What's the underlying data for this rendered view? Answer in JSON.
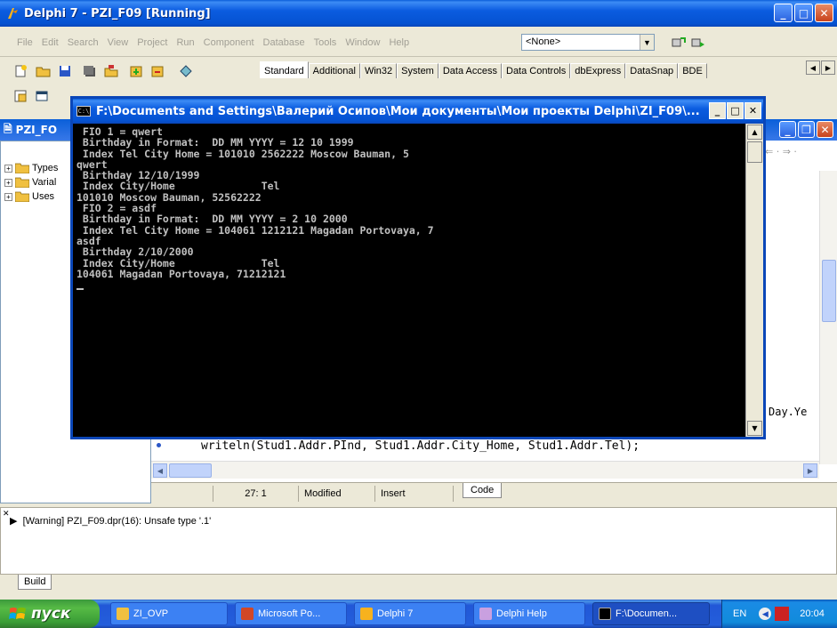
{
  "main_window": {
    "title": "Delphi 7 - PZI_F09 [Running]",
    "buttons": {
      "minimize": "_",
      "maximize": "□",
      "close": "✕"
    }
  },
  "menu": {
    "items": [
      "File",
      "Edit",
      "Search",
      "View",
      "Project",
      "Run",
      "Component",
      "Database",
      "Tools",
      "Window",
      "Help"
    ],
    "combo_value": "<None>"
  },
  "palette": {
    "tabs": [
      "Standard",
      "Additional",
      "Win32",
      "System",
      "Data Access",
      "Data Controls",
      "dbExpress",
      "DataSnap",
      "BDE"
    ]
  },
  "explorer": {
    "title": "PZI_FO",
    "tree": [
      "Types",
      "Varial",
      "Uses"
    ]
  },
  "editor": {
    "code_line": "writeln(Stud1.Addr.PInd, Stud1.Addr.City_Home, Stud1.Addr.Tel);",
    "code_day": "Day.Ye",
    "status": {
      "position": "27:   1",
      "modified": "Modified",
      "insert": "Insert",
      "tab": "Code"
    }
  },
  "console": {
    "title": "F:\\Documents and Settings\\Валерий Осипов\\Мои документы\\Мои проекты Delphi\\ZI_F09\\...",
    "lines": [
      " FIO 1 = qwert",
      " Birthday in Format:  DD MM YYYY = 12 10 1999",
      " Index Tel City Home = 101010 2562222 Moscow Bauman, 5",
      "qwert",
      " Birthday 12/10/1999",
      " Index City/Home              Tel",
      "101010 Moscow Bauman, 52562222",
      " FIO 2 = asdf",
      " Birthday in Format:  DD MM YYYY = 2 10 2000",
      " Index Tel City Home = 104061 1212121 Magadan Portovaya, 7",
      "asdf",
      " Birthday 2/10/2000",
      " Index City/Home              Tel",
      "104061 Magadan Portovaya, 71212121"
    ]
  },
  "messages": {
    "line": "[Warning] PZI_F09.dpr(16): Unsafe type '.1'",
    "tab": "Build"
  },
  "taskbar": {
    "start": "пуск",
    "tasks": [
      "ZI_OVP",
      "Microsoft Po...",
      "Delphi 7",
      "Delphi Help",
      "F:\\Documen..."
    ],
    "lang": "EN",
    "clock": "20:04"
  },
  "colors": {
    "xp_blue": "#0552d1",
    "console_bg": "#000000",
    "console_fg": "#c0c0c0",
    "start_green": "#3a9d36"
  }
}
